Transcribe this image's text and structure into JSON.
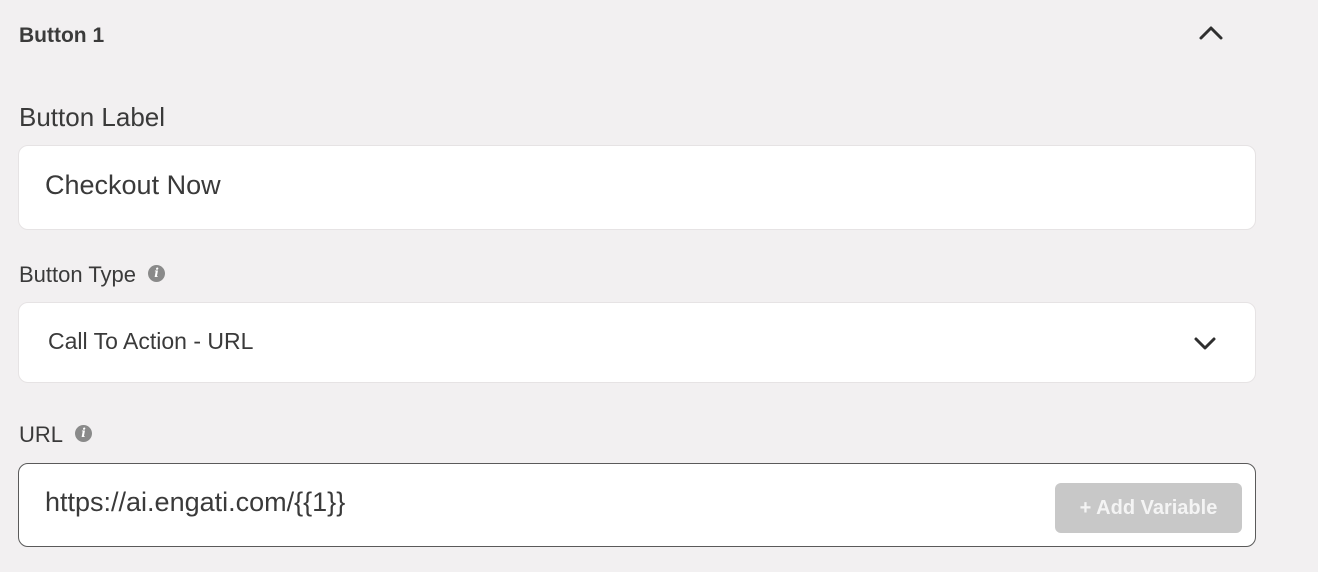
{
  "section": {
    "title": "Button 1"
  },
  "button_label": {
    "label": "Button Label",
    "value": "Checkout Now"
  },
  "button_type": {
    "label": "Button Type",
    "selected": "Call To Action - URL"
  },
  "url": {
    "label": "URL",
    "value": "https://ai.engati.com/{{1}}",
    "add_variable_label": "+ Add Variable"
  },
  "icons": {
    "info": "i",
    "collapse": "chevron-up-icon",
    "dropdown": "chevron-down-icon"
  },
  "colors": {
    "background": "#f2f0f1",
    "field": "#ffffff",
    "add_variable_disabled": "#c8c8c8"
  }
}
